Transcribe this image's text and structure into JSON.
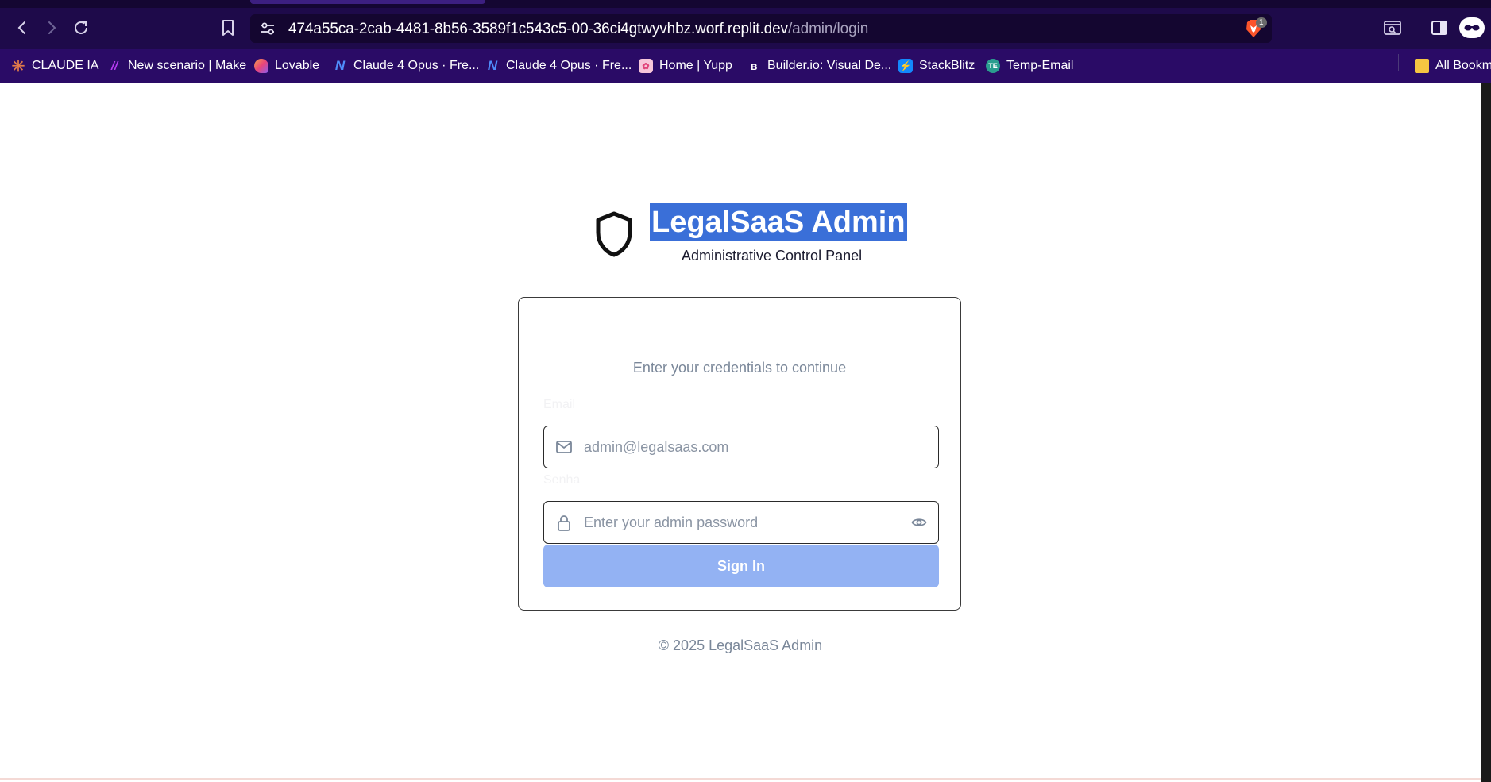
{
  "browser": {
    "url_host": "474a55ca-2cab-4481-8b56-3589f1c543c5-00-36ci4gtwyvhbz.worf.replit.dev",
    "url_path": "/admin/login",
    "brave_badge_count": "1",
    "bookmarks": [
      {
        "label": "CLAUDE IA",
        "icon": "claude-asterisk-icon",
        "color": "#e07a4a"
      },
      {
        "label": "New scenario | Make",
        "icon": "make-logo-icon",
        "color": "#b63cf0"
      },
      {
        "label": "Lovable",
        "icon": "lovable-heart-icon",
        "color": "#f0607a"
      },
      {
        "label": "Claude 4 Opus · Fre...",
        "icon": "n-logo-icon",
        "color": "#3b82f6"
      },
      {
        "label": "Claude 4 Opus · Fre...",
        "icon": "n-logo-icon",
        "color": "#3b82f6"
      },
      {
        "label": "Home | Yupp",
        "icon": "yupp-icon",
        "color": "#f7c6d9"
      },
      {
        "label": "Builder.io: Visual De...",
        "icon": "builder-icon",
        "color": "#ffffff"
      },
      {
        "label": "StackBlitz",
        "icon": "lightning-icon",
        "color": "#1389fd"
      },
      {
        "label": "Temp-Email",
        "icon": "temp-email-icon",
        "color": "#2a9d8f"
      }
    ],
    "all_bookmarks_label": "All Bookma"
  },
  "brand": {
    "title": "LegalSaaS Admin",
    "subtitle": "Administrative Control Panel",
    "icon": "shield-icon"
  },
  "login": {
    "description": "Enter your credentials to continue",
    "email_label": "Email",
    "email_placeholder": "admin@legalsaas.com",
    "password_label": "Senha",
    "password_placeholder": "Enter your admin password",
    "submit_label": "Sign In"
  },
  "footer": {
    "copyright": "© 2025 LegalSaaS Admin"
  },
  "colors": {
    "chrome_bg": "#1e0a4a",
    "bookmarks_bg": "#2a0b66",
    "selection": "#3a6fd8",
    "button_bg": "#93b2f3",
    "muted_text": "#7a8799"
  }
}
